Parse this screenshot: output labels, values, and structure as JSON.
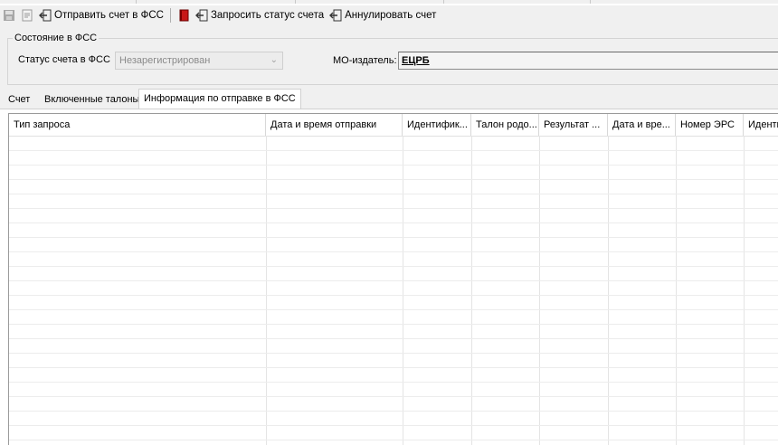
{
  "toolbar": {
    "send_label": "Отправить счет в ФСС",
    "request_label": "Запросить статус счета",
    "cancel_label": "Аннулировать счет"
  },
  "fss_state": {
    "title": "Состояние в ФСС",
    "status_label": "Статус счета в ФСС",
    "status_value": "Незарегистрирован",
    "issuer_label": "МО-издатель:",
    "issuer_value": "ЕЦРБ"
  },
  "tabs": [
    "Счет",
    "Включенные талоны",
    "Информация по отправке в ФСС"
  ],
  "grid": {
    "columns": [
      "Тип запроса",
      "Дата и время отправки",
      "Идентифик...",
      "Талон родо...",
      "Результат ...",
      "Дата и вре...",
      "Номер ЭРС",
      "Идентиф"
    ]
  }
}
